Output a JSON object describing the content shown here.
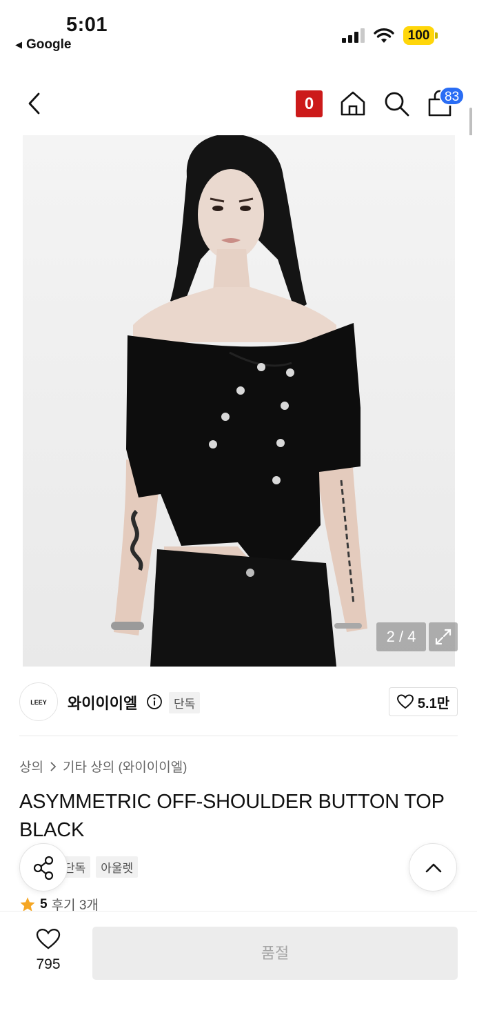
{
  "status_bar": {
    "time": "5:01",
    "back_app": "Google",
    "battery": "100"
  },
  "nav": {
    "brand_badge": "0",
    "cart_count": "83"
  },
  "gallery": {
    "counter": "2 / 4"
  },
  "brand": {
    "logo_text": "LEEY",
    "name": "와이이이엘",
    "tag": "단독",
    "likes": "5.1만"
  },
  "breadcrumb": {
    "category": "상의",
    "subcategory": "기타 상의 (와이이이엘)"
  },
  "product": {
    "title": "ASYMMETRIC OFF-SHOULDER BUTTON TOP BLACK",
    "tags": [
      "단독",
      "아울렛"
    ],
    "rating": "5",
    "reviews": "후기 3개"
  },
  "bottom": {
    "wish_count": "795",
    "buy_label": "품절"
  },
  "colors": {
    "accent": "#2a6df4",
    "brand_badge": "#cc1a1a",
    "star": "#f5a623"
  }
}
